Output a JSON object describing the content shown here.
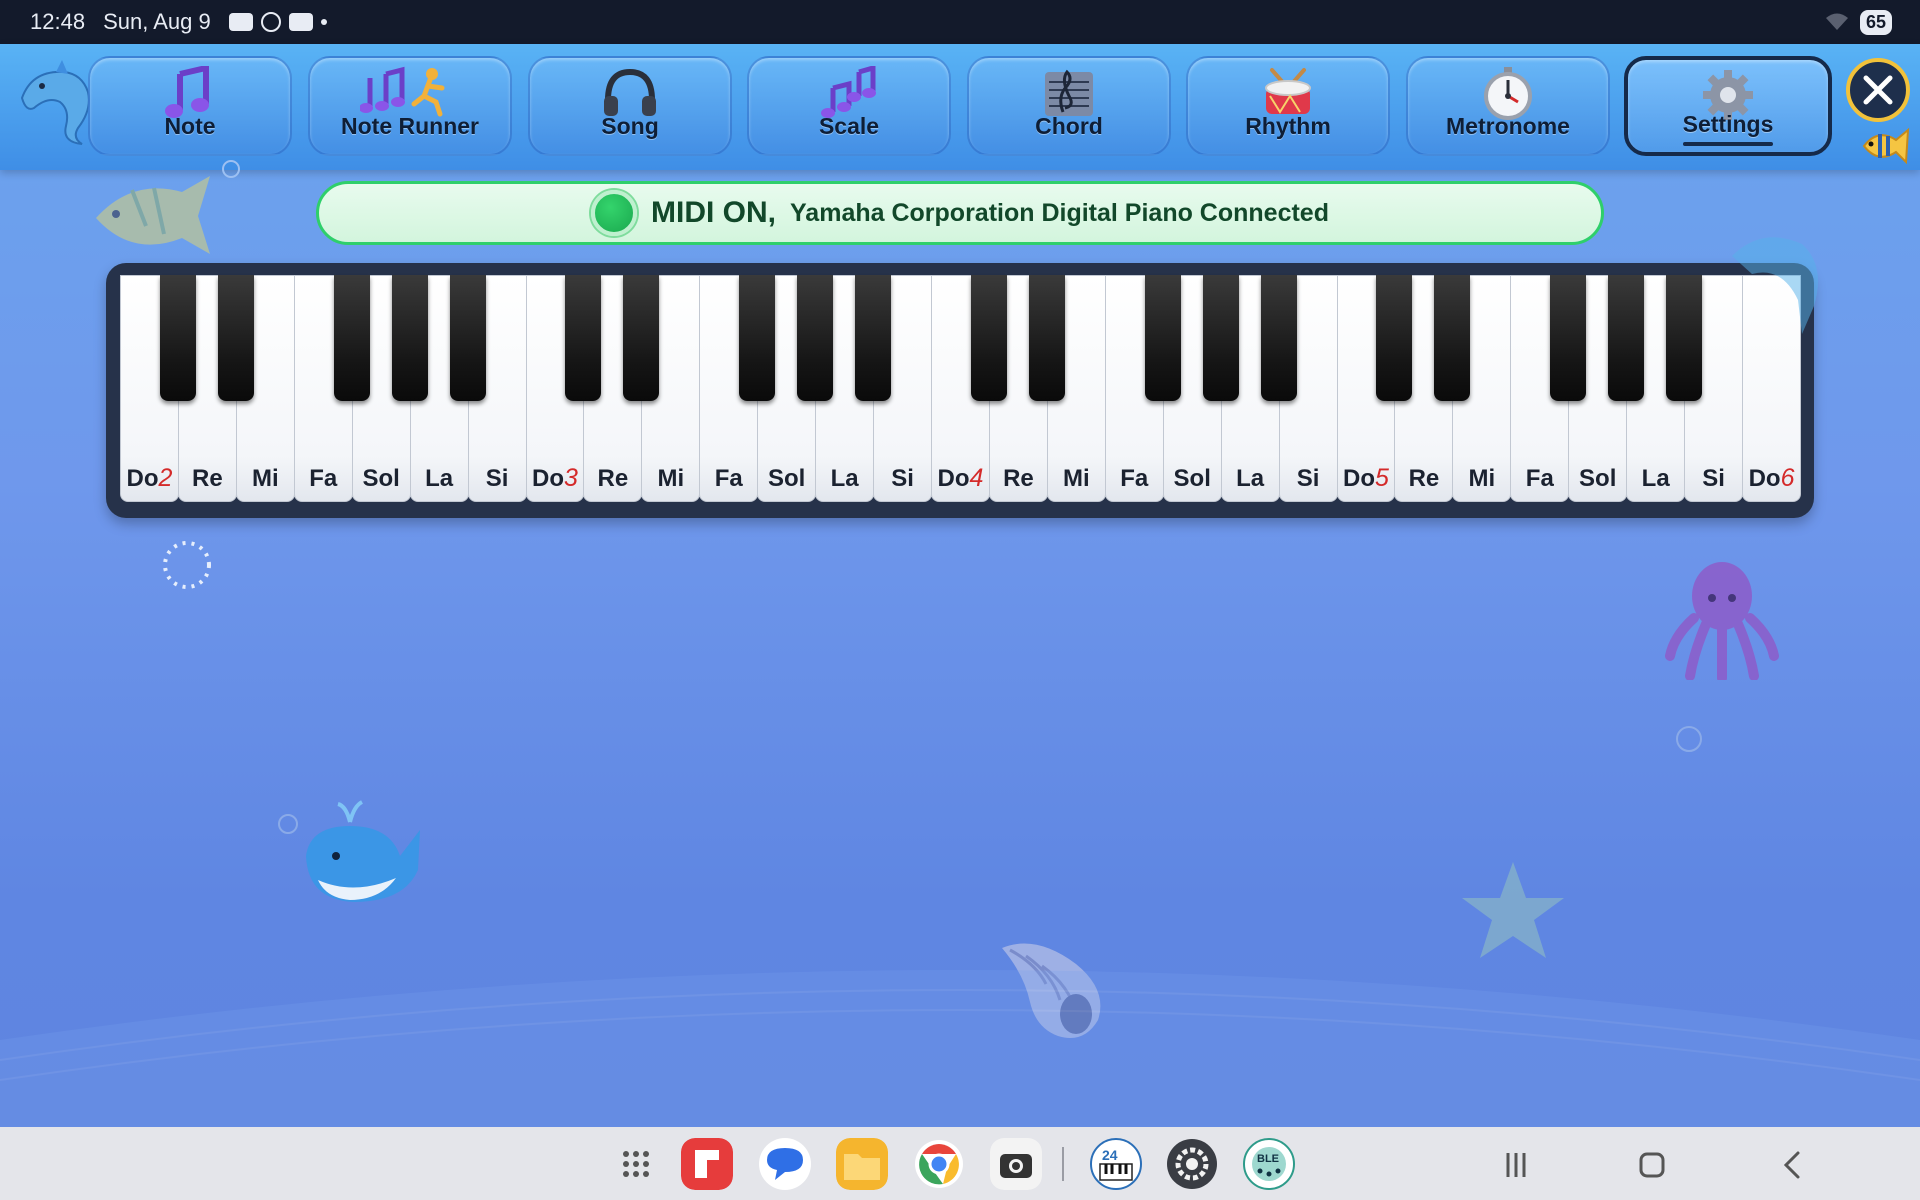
{
  "status_bar": {
    "time": "12:48",
    "date": "Sun, Aug 9",
    "battery": "65"
  },
  "nav": {
    "tabs": [
      {
        "label": "Note",
        "icon": "music-note-icon"
      },
      {
        "label": "Note Runner",
        "icon": "running-notes-icon"
      },
      {
        "label": "Song",
        "icon": "headphones-icon"
      },
      {
        "label": "Scale",
        "icon": "scale-notes-icon"
      },
      {
        "label": "Chord",
        "icon": "sheet-music-icon"
      },
      {
        "label": "Rhythm",
        "icon": "drum-icon"
      },
      {
        "label": "Metronome",
        "icon": "stopwatch-icon"
      },
      {
        "label": "Settings",
        "icon": "gear-icon",
        "active": true
      }
    ],
    "close_icon": "close-icon"
  },
  "midi": {
    "status": "MIDI ON,",
    "device": "Yamaha Corporation Digital Piano Connected",
    "indicator_color": "#22c55e"
  },
  "piano": {
    "white_keys": [
      {
        "label": "Do",
        "octave": "2"
      },
      {
        "label": "Re"
      },
      {
        "label": "Mi"
      },
      {
        "label": "Fa"
      },
      {
        "label": "Sol"
      },
      {
        "label": "La"
      },
      {
        "label": "Si"
      },
      {
        "label": "Do",
        "octave": "3"
      },
      {
        "label": "Re"
      },
      {
        "label": "Mi"
      },
      {
        "label": "Fa"
      },
      {
        "label": "Sol"
      },
      {
        "label": "La"
      },
      {
        "label": "Si"
      },
      {
        "label": "Do",
        "octave": "4"
      },
      {
        "label": "Re"
      },
      {
        "label": "Mi"
      },
      {
        "label": "Fa"
      },
      {
        "label": "Sol"
      },
      {
        "label": "La"
      },
      {
        "label": "Si"
      },
      {
        "label": "Do",
        "octave": "5"
      },
      {
        "label": "Re"
      },
      {
        "label": "Mi"
      },
      {
        "label": "Fa"
      },
      {
        "label": "Sol"
      },
      {
        "label": "La"
      },
      {
        "label": "Si"
      },
      {
        "label": "Do",
        "octave": "6"
      }
    ]
  },
  "decorations": [
    "dolphin-icon",
    "angelfish-icon",
    "whale-icon",
    "octopus-icon",
    "starfish-icon",
    "shell-icon",
    "tropical-fish-icon"
  ],
  "dock": {
    "apps": [
      "app-drawer-icon",
      "flipboard-icon",
      "messages-icon",
      "files-icon",
      "chrome-icon",
      "camera-icon",
      "piano-app-icon",
      "settings-app-icon",
      "ble-midi-icon"
    ],
    "system": [
      "recents-icon",
      "home-icon",
      "back-icon"
    ]
  },
  "colors": {
    "accent": "#2fcf6b",
    "nav_bg": "#4ea2ee",
    "octave_number": "#d42a2a",
    "active_tab_border": "#152a4a"
  }
}
